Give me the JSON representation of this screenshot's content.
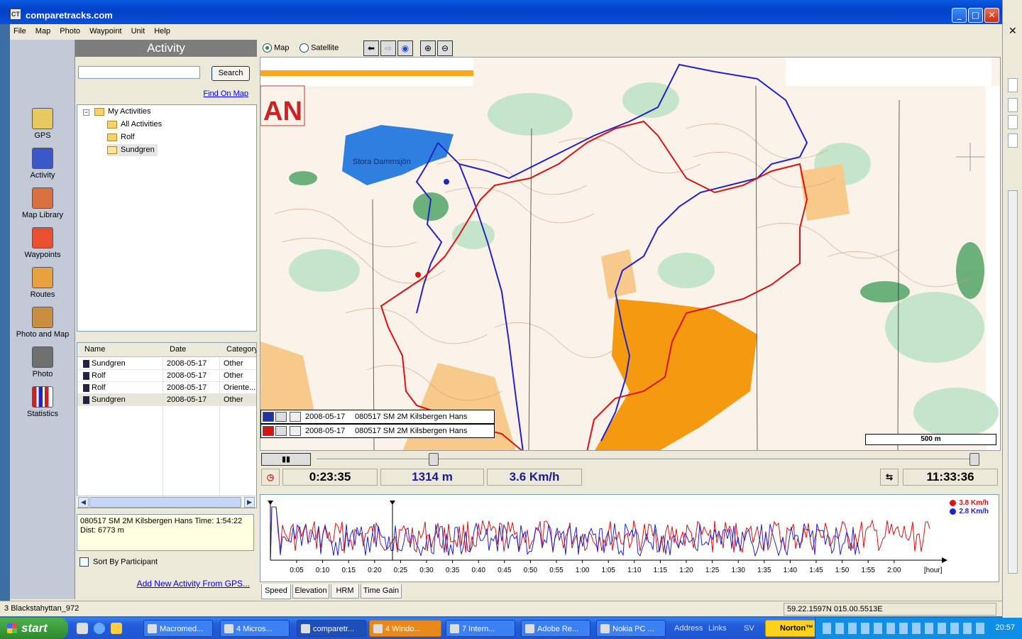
{
  "window": {
    "title": "comparetracks.com",
    "icon_text": "CT"
  },
  "menu": [
    "File",
    "Map",
    "Photo",
    "Waypoint",
    "Unit",
    "Help"
  ],
  "nav": [
    {
      "label": "GPS",
      "icon": "gps-icon"
    },
    {
      "label": "Activity",
      "icon": "activity-icon"
    },
    {
      "label": "Map Library",
      "icon": "map-library-icon"
    },
    {
      "label": "Waypoints",
      "icon": "waypoints-icon"
    },
    {
      "label": "Routes",
      "icon": "routes-icon"
    },
    {
      "label": "Photo and Map",
      "icon": "photo-and-map-icon"
    },
    {
      "label": "Photo",
      "icon": "camera-icon"
    },
    {
      "label": "Statistics",
      "icon": "statistics-icon"
    }
  ],
  "panel": {
    "title": "Activity",
    "search_value": "",
    "search_button": "Search",
    "find_link": "Find On Map",
    "tree": {
      "root": "My Activities",
      "children": [
        "All Activities",
        "Rolf",
        "Sundgren"
      ]
    },
    "list": {
      "columns": [
        "Name",
        "Date",
        "Category"
      ],
      "rows": [
        {
          "name": "Sundgren",
          "date": "2008-05-17",
          "category": "Other"
        },
        {
          "name": "Rolf",
          "date": "2008-05-17",
          "category": "Other"
        },
        {
          "name": "Rolf",
          "date": "2008-05-17",
          "category": "Oriente..."
        },
        {
          "name": "Sundgren",
          "date": "2008-05-17",
          "category": "Other"
        }
      ]
    },
    "info": "080517 SM 2M Kilsbergen Hans Time: 1:54:22 Dist: 6773 m",
    "sort_label": "Sort By Participant",
    "add_link": "Add New Activity From GPS..."
  },
  "map_toolbar": {
    "map_label": "Map",
    "satellite_label": "Satellite",
    "selected": "Map"
  },
  "map": {
    "lake_label": "Stora Dammsjön",
    "title_fragment": "AN",
    "scale_label": "500 m",
    "tracks": [
      {
        "date": "2008-05-17",
        "name": "080517 SM 2M Kilsbergen Hans",
        "color": "#2222cc"
      },
      {
        "date": "2008-05-17",
        "name": "080517 SM 2M Kilsbergen Hans",
        "color": "#dd1111"
      }
    ]
  },
  "playback": {
    "play_icon": "pause-icon"
  },
  "readout": {
    "elapsed": "0:23:35",
    "distance": "1314 m",
    "speed": "3.6 Km/h",
    "clock": "11:33:36"
  },
  "speed_chart": {
    "legend": [
      {
        "label": "3.8 Km/h",
        "color": "#dd1111"
      },
      {
        "label": "2.8 Km/h",
        "color": "#2222cc"
      }
    ],
    "ticks": [
      "0:05",
      "0:10",
      "0:15",
      "0:20",
      "0:25",
      "0:30",
      "0:35",
      "0:40",
      "0:45",
      "0:50",
      "0:55",
      "1:00",
      "1:05",
      "1:10",
      "1:15",
      "1:20",
      "1:25",
      "1:30",
      "1:35",
      "1:40",
      "1:45",
      "1:50",
      "1:55",
      "2:00"
    ],
    "unit": "[hour]"
  },
  "tabs": [
    "Speed",
    "Elevation",
    "HRM",
    "Time Gain"
  ],
  "status": {
    "left": "Blackstahyttan_972",
    "coords": "59.22.1597N 015.00.5513E",
    "left_prefix": "3"
  },
  "taskbar": {
    "start": "start",
    "tasks": [
      {
        "label": "Macromed...",
        "style": "normal"
      },
      {
        "label": "4 Micros...",
        "style": "normal"
      },
      {
        "label": "comparetr...",
        "style": "active"
      },
      {
        "label": "4 Windo...",
        "style": "orange"
      },
      {
        "label": "7 Intern...",
        "style": "normal"
      },
      {
        "label": "Adobe Re...",
        "style": "normal"
      },
      {
        "label": "Nokia PC ...",
        "style": "normal"
      }
    ],
    "address": "Address",
    "links": "Links",
    "lang": "SV",
    "norton": "Norton™",
    "clock": "20:57"
  }
}
